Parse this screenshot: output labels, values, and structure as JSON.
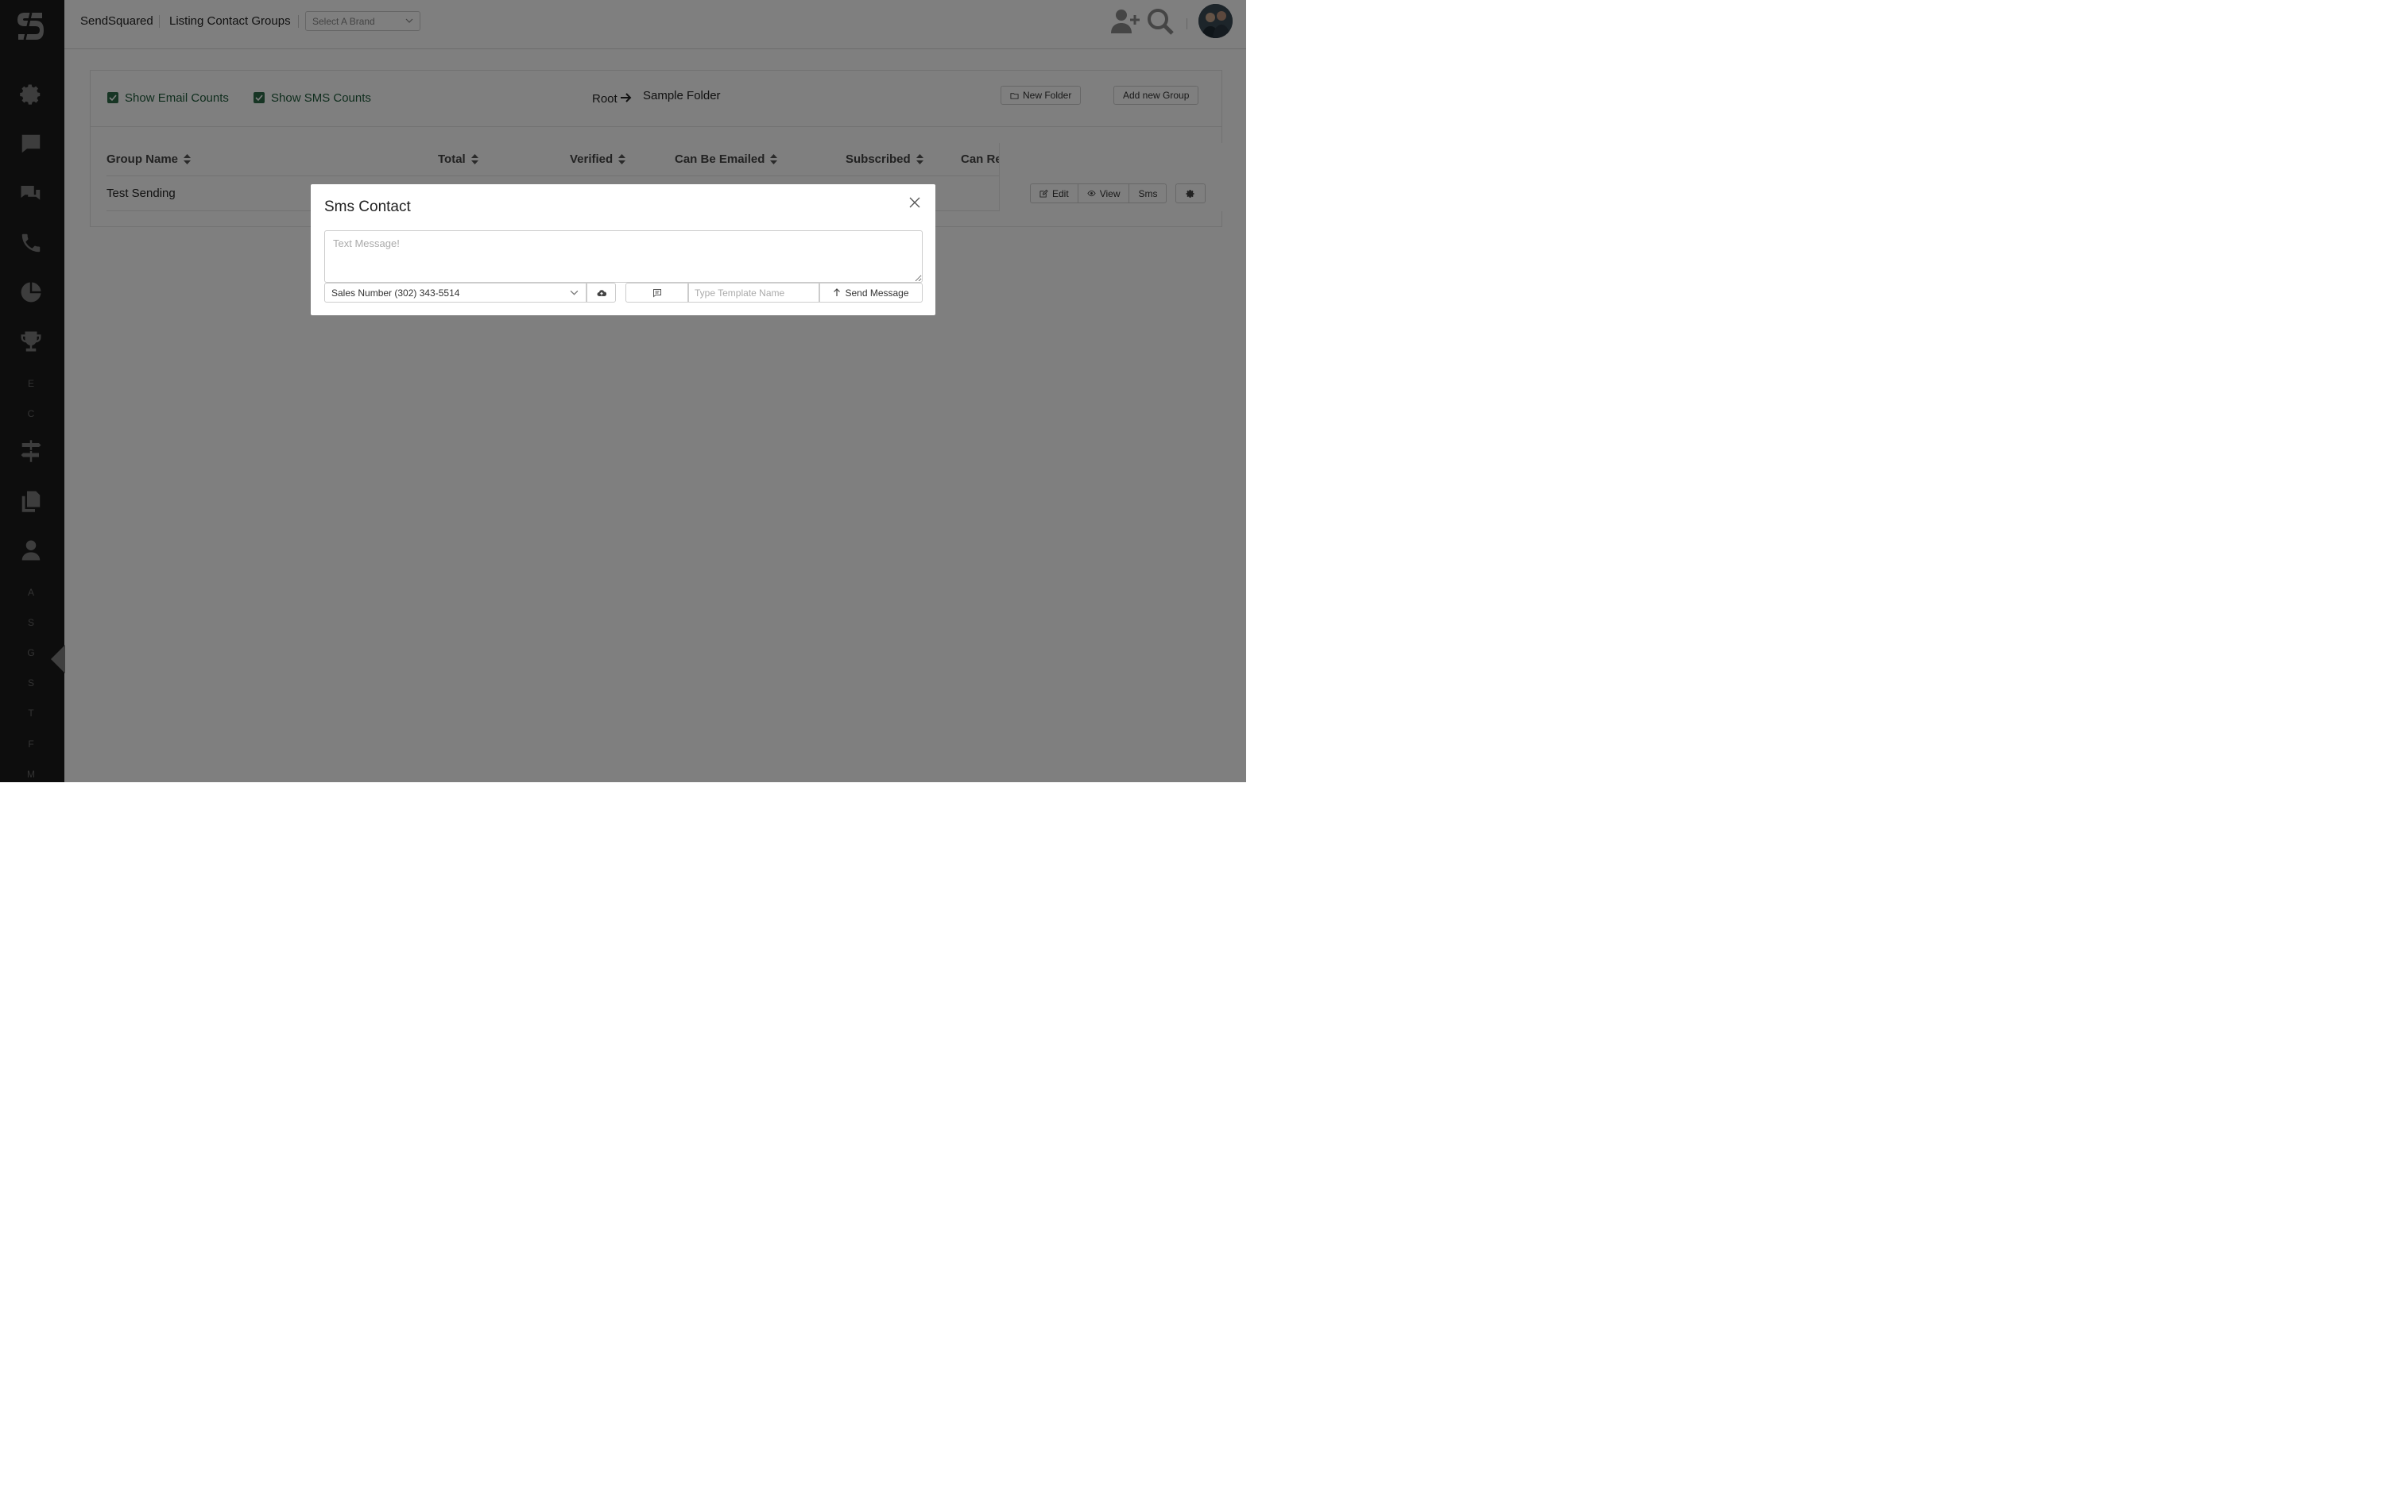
{
  "header": {
    "brand_name": "SendSquared",
    "page_title": "Listing Contact Groups",
    "brand_select_placeholder": "Select A Brand",
    "icons": [
      "add-user-icon",
      "search-icon",
      "avatar"
    ]
  },
  "sidebar": {
    "icons": [
      "gear-icon",
      "chat-bubble-icon",
      "chat-bubbles-icon",
      "phone-icon",
      "pie-chart-icon",
      "trophy-icon",
      "signpost-icon",
      "copy-icon",
      "user-icon"
    ],
    "letters_top": [
      "E",
      "C"
    ],
    "letters_bottom": [
      "A",
      "S",
      "G",
      "S",
      "T",
      "F",
      "M"
    ]
  },
  "toolbar": {
    "show_email_counts": "Show Email Counts",
    "show_sms_counts": "Show SMS Counts",
    "breadcrumb_root": "Root",
    "breadcrumb_folder": "Sample Folder",
    "new_folder": "New Folder",
    "add_group": "Add new Group"
  },
  "table": {
    "columns": [
      "Group Name",
      "Total",
      "Verified",
      "Can Be Emailed",
      "Subscribed",
      "Can Re"
    ],
    "rows": [
      {
        "group_name": "Test Sending"
      }
    ],
    "actions": {
      "edit": "Edit",
      "view": "View",
      "sms": "Sms"
    }
  },
  "modal": {
    "title": "Sms Contact",
    "message_placeholder": "Text Message!",
    "from_number": "Sales Number (302) 343-5514",
    "template_placeholder": "Type Template Name",
    "send_label": "Send Message"
  },
  "colors": {
    "sidebar_bg": "#1b1b1b",
    "checkbox_green": "#2e6b48",
    "overlay": "rgba(0,0,0,0.5)"
  }
}
